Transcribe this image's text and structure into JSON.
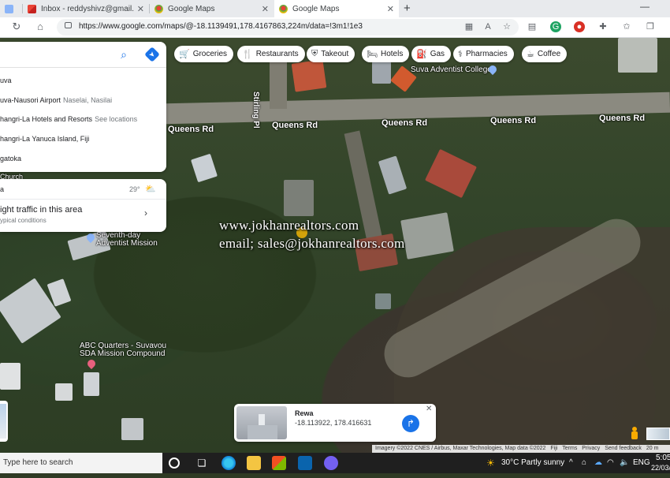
{
  "browser": {
    "tabs": [
      {
        "label": "",
        "active": false
      },
      {
        "label": "Inbox - reddyshivz@gmail.com",
        "active": false
      },
      {
        "label": "Google Maps",
        "active": false
      },
      {
        "label": "Google Maps",
        "active": true
      }
    ],
    "url": "https://www.google.com/maps/@-18.1139491,178.4167863,224m/data=!3m1!1e3"
  },
  "chips": [
    {
      "label": "Groceries",
      "icon": "cart-icon"
    },
    {
      "label": "Restaurants",
      "icon": "fork-knife-icon"
    },
    {
      "label": "Takeout",
      "icon": "takeout-icon"
    },
    {
      "label": "Hotels",
      "icon": "bed-icon"
    },
    {
      "label": "Gas",
      "icon": "gas-icon"
    },
    {
      "label": "Pharmacies",
      "icon": "pharmacy-icon"
    },
    {
      "label": "Coffee",
      "icon": "coffee-icon"
    }
  ],
  "search_panel": {
    "suggestions": [
      {
        "label": "uva",
        "sub": ""
      },
      {
        "label": "uva-Nausori Airport",
        "sub": "Naselai, Nasilai"
      },
      {
        "label": "hangri-La Hotels and Resorts",
        "sub": "See locations"
      },
      {
        "label": "hangri-La Yanuca Island, Fiji",
        "sub": ""
      },
      {
        "label": "gatoka",
        "sub": ""
      }
    ],
    "below_label": "Church"
  },
  "weather_panel": {
    "place": "a",
    "temp": "29°",
    "traffic_title": "ight traffic in this area",
    "traffic_sub": "ypical conditions"
  },
  "map": {
    "roads": [
      {
        "label": "Queens Rd"
      },
      {
        "label": "Queens Rd"
      },
      {
        "label": "Queens Rd"
      },
      {
        "label": "Queens Rd"
      },
      {
        "label": "Queens Rd"
      }
    ],
    "street": "Stirling Pl",
    "places": {
      "college": "Suva Adventist College",
      "mission": "Seventh-day Adventist Mission",
      "abc_line1": "ABC Quarters - Suvavou",
      "abc_line2": "SDA Mission Compound"
    },
    "watermark_line1": "www.jokhanrealtors.com",
    "watermark_line2": "email; sales@jokhanrealtors.com"
  },
  "place_card": {
    "title": "Rewa",
    "coords": "-18.113922, 178.416631"
  },
  "attribution": [
    "Imagery ©2022 CNES / Airbus, Maxar Technologies, Map data ©2022",
    "Fiji",
    "Terms",
    "Privacy",
    "Send feedback",
    "20 m"
  ],
  "taskbar": {
    "search_placeholder": "Type here to search",
    "weather": "30°C  Partly sunny",
    "lang": "ENG",
    "time": "5:05",
    "date": "22/03/"
  },
  "colors": {
    "accent": "#1a73e8"
  }
}
